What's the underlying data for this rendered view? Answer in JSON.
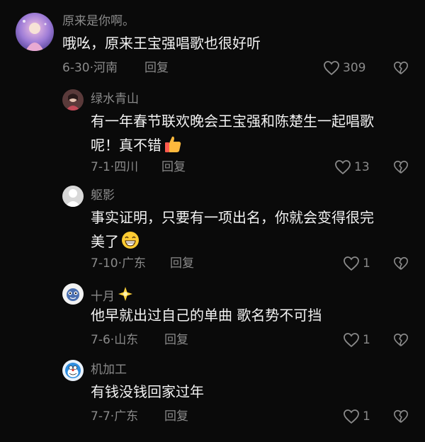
{
  "comments": [
    {
      "user": "原来是你啊。",
      "text_lines": [
        "哦吆，原来王宝强唱歌也很好听"
      ],
      "date": "6-30",
      "location": "河南",
      "reply_label": "回复",
      "likes": "309"
    },
    {
      "user": "绿水青山",
      "text_lines": [
        "有一年春节联欢晚会王宝强和陈楚生一起唱歌",
        "呢！真不错"
      ],
      "emoji": "thumbs-up",
      "date": "7-1",
      "location": "四川",
      "reply_label": "回复",
      "likes": "13"
    },
    {
      "user": "躯影",
      "text_lines": [
        "事实证明，只要有一项出名，你就会变得很完",
        "美了"
      ],
      "emoji": "grinning-face",
      "date": "7-10",
      "location": "广东",
      "reply_label": "回复",
      "likes": "1"
    },
    {
      "user": "十月",
      "user_badge": "sparkle-star",
      "text_lines": [
        "他早就出过自己的单曲 歌名势不可挡"
      ],
      "date": "7-6",
      "location": "山东",
      "reply_label": "回复",
      "likes": "1"
    },
    {
      "user": "机加工",
      "text_lines": [
        "有钱没钱回家过年"
      ],
      "date": "7-7",
      "location": "广东",
      "reply_label": "回复",
      "likes": "1"
    }
  ],
  "meta_separator": "·",
  "colors": {
    "background": "#0a0a0a",
    "text": "#f2f2f2",
    "secondary": "#8a8a8a"
  }
}
